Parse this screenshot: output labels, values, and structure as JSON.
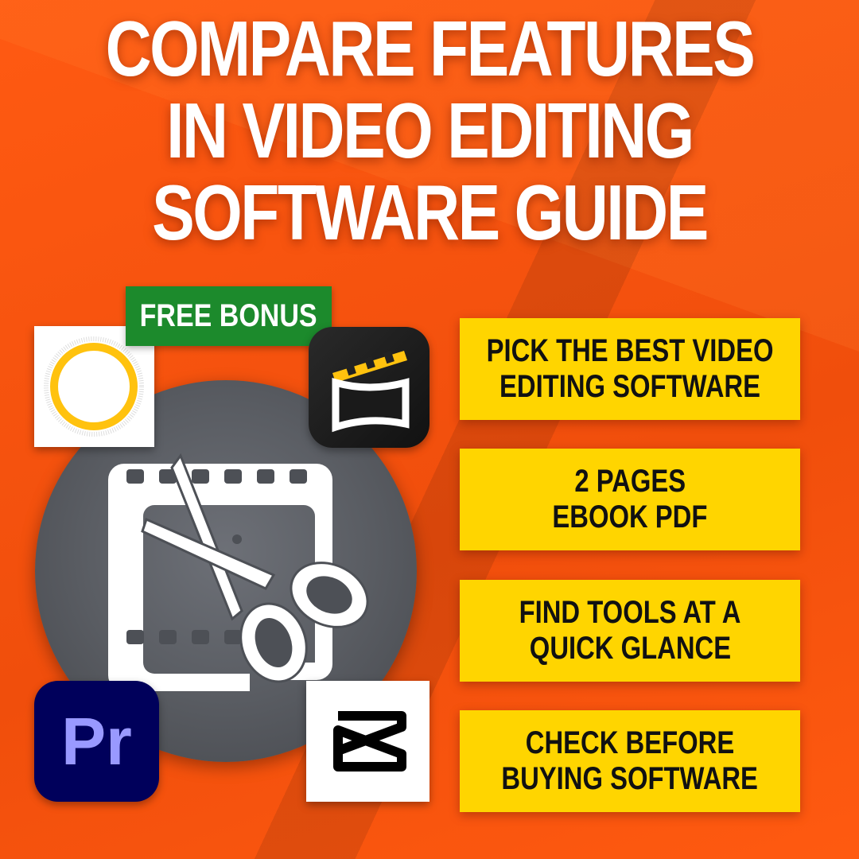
{
  "headline": {
    "lines": [
      "COMPARE FEATURES",
      "IN VIDEO EDITING",
      "SOFTWARE GUIDE"
    ]
  },
  "badge": {
    "label": "FREE BONUS"
  },
  "app_icons": [
    {
      "name": "sun-app-icon"
    },
    {
      "name": "clapperboard-app-icon"
    },
    {
      "name": "premiere-pro-icon",
      "label": "Pr"
    },
    {
      "name": "capcut-icon"
    }
  ],
  "feature_cards": [
    {
      "lines": [
        "PICK THE BEST VIDEO",
        "EDITING SOFTWARE"
      ]
    },
    {
      "lines": [
        "2 PAGES",
        "EBOOK PDF"
      ]
    },
    {
      "lines": [
        "FIND TOOLS AT A",
        "QUICK GLANCE"
      ]
    },
    {
      "lines": [
        "CHECK BEFORE",
        "BUYING SOFTWARE"
      ]
    }
  ],
  "colors": {
    "background": "#f5520f",
    "card": "#ffd500",
    "badge": "#1c8a2c",
    "premiere_bg": "#00005b",
    "premiere_text": "#9999ff"
  }
}
